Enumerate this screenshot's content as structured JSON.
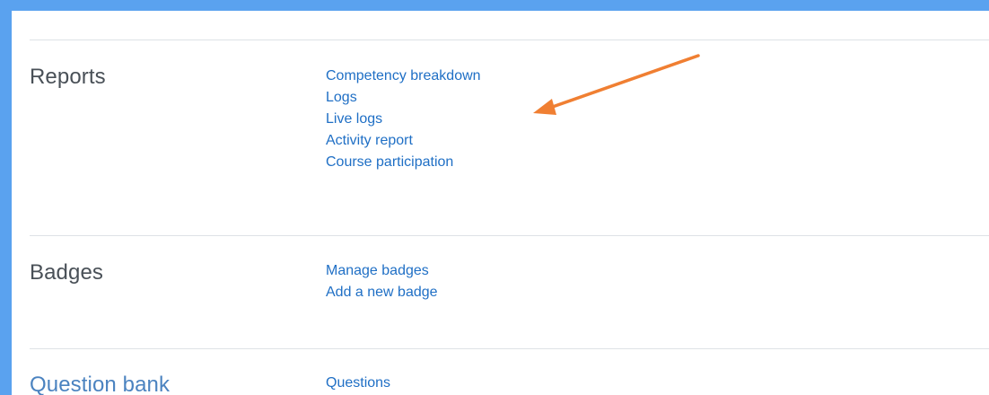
{
  "sections": [
    {
      "title": "Reports",
      "links": [
        "Competency breakdown",
        "Logs",
        "Live logs",
        "Activity report",
        "Course participation"
      ]
    },
    {
      "title": "Badges",
      "links": [
        "Manage badges",
        "Add a new badge"
      ]
    },
    {
      "title": "Question bank",
      "links": [
        "Questions"
      ]
    }
  ],
  "colors": {
    "frame": "#5aa2ef",
    "link": "#1f6fc5",
    "arrow": "#f07f32"
  }
}
